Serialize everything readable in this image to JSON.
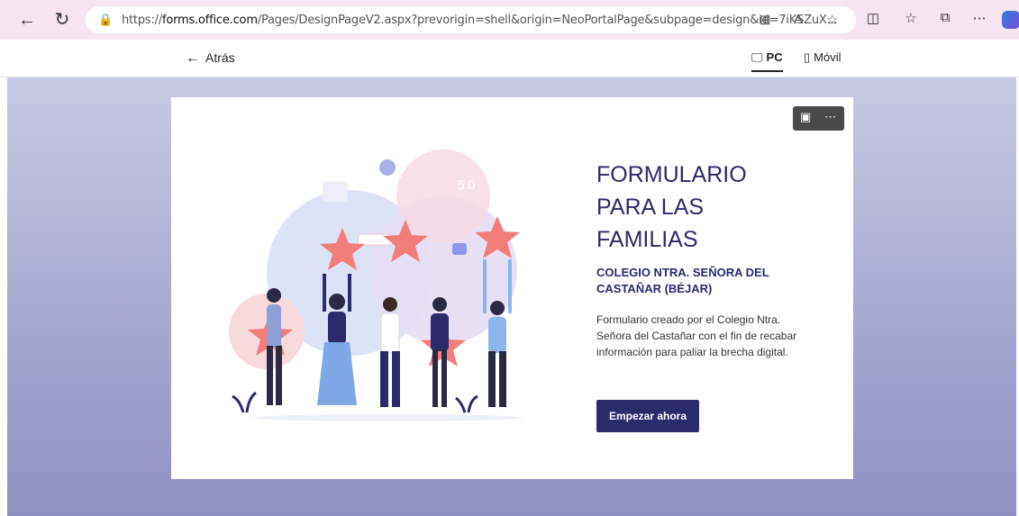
{
  "browser": {
    "url_prefix": "https://",
    "url_domain": "forms.office.com",
    "url_rest": "/Pages/DesignPageV2.aspx?prevorigin=shell&origin=NeoPortalPage&subpage=design&id=7iKSZuX...",
    "icons": [
      "back-icon",
      "refresh-icon",
      "lock-icon",
      "app-grid-icon",
      "read-aloud-icon",
      "favorite-icon",
      "split-screen-icon",
      "favorites-icon",
      "collections-icon",
      "more-icon",
      "copilot-icon"
    ]
  },
  "header": {
    "back_label": "Atrás",
    "view_pc_label": "PC",
    "view_mobile_label": "Móvil"
  },
  "form": {
    "title": "FORMULARIO PARA LAS FAMILIAS",
    "subtitle": "COLEGIO NTRA. SEÑORA DEL CASTAÑAR (BÉJAR)",
    "description": "Formulario creado por el Colegio Ntra. Señora del Castañar con el fin de recabar información para paliar la brecha digital.",
    "start_button": "Empezar ahora",
    "rating_badge": "5.0"
  },
  "colors": {
    "accent": "#2b2a6b",
    "browser_bar": "#f7e4f1",
    "star": "#f27d7a"
  }
}
